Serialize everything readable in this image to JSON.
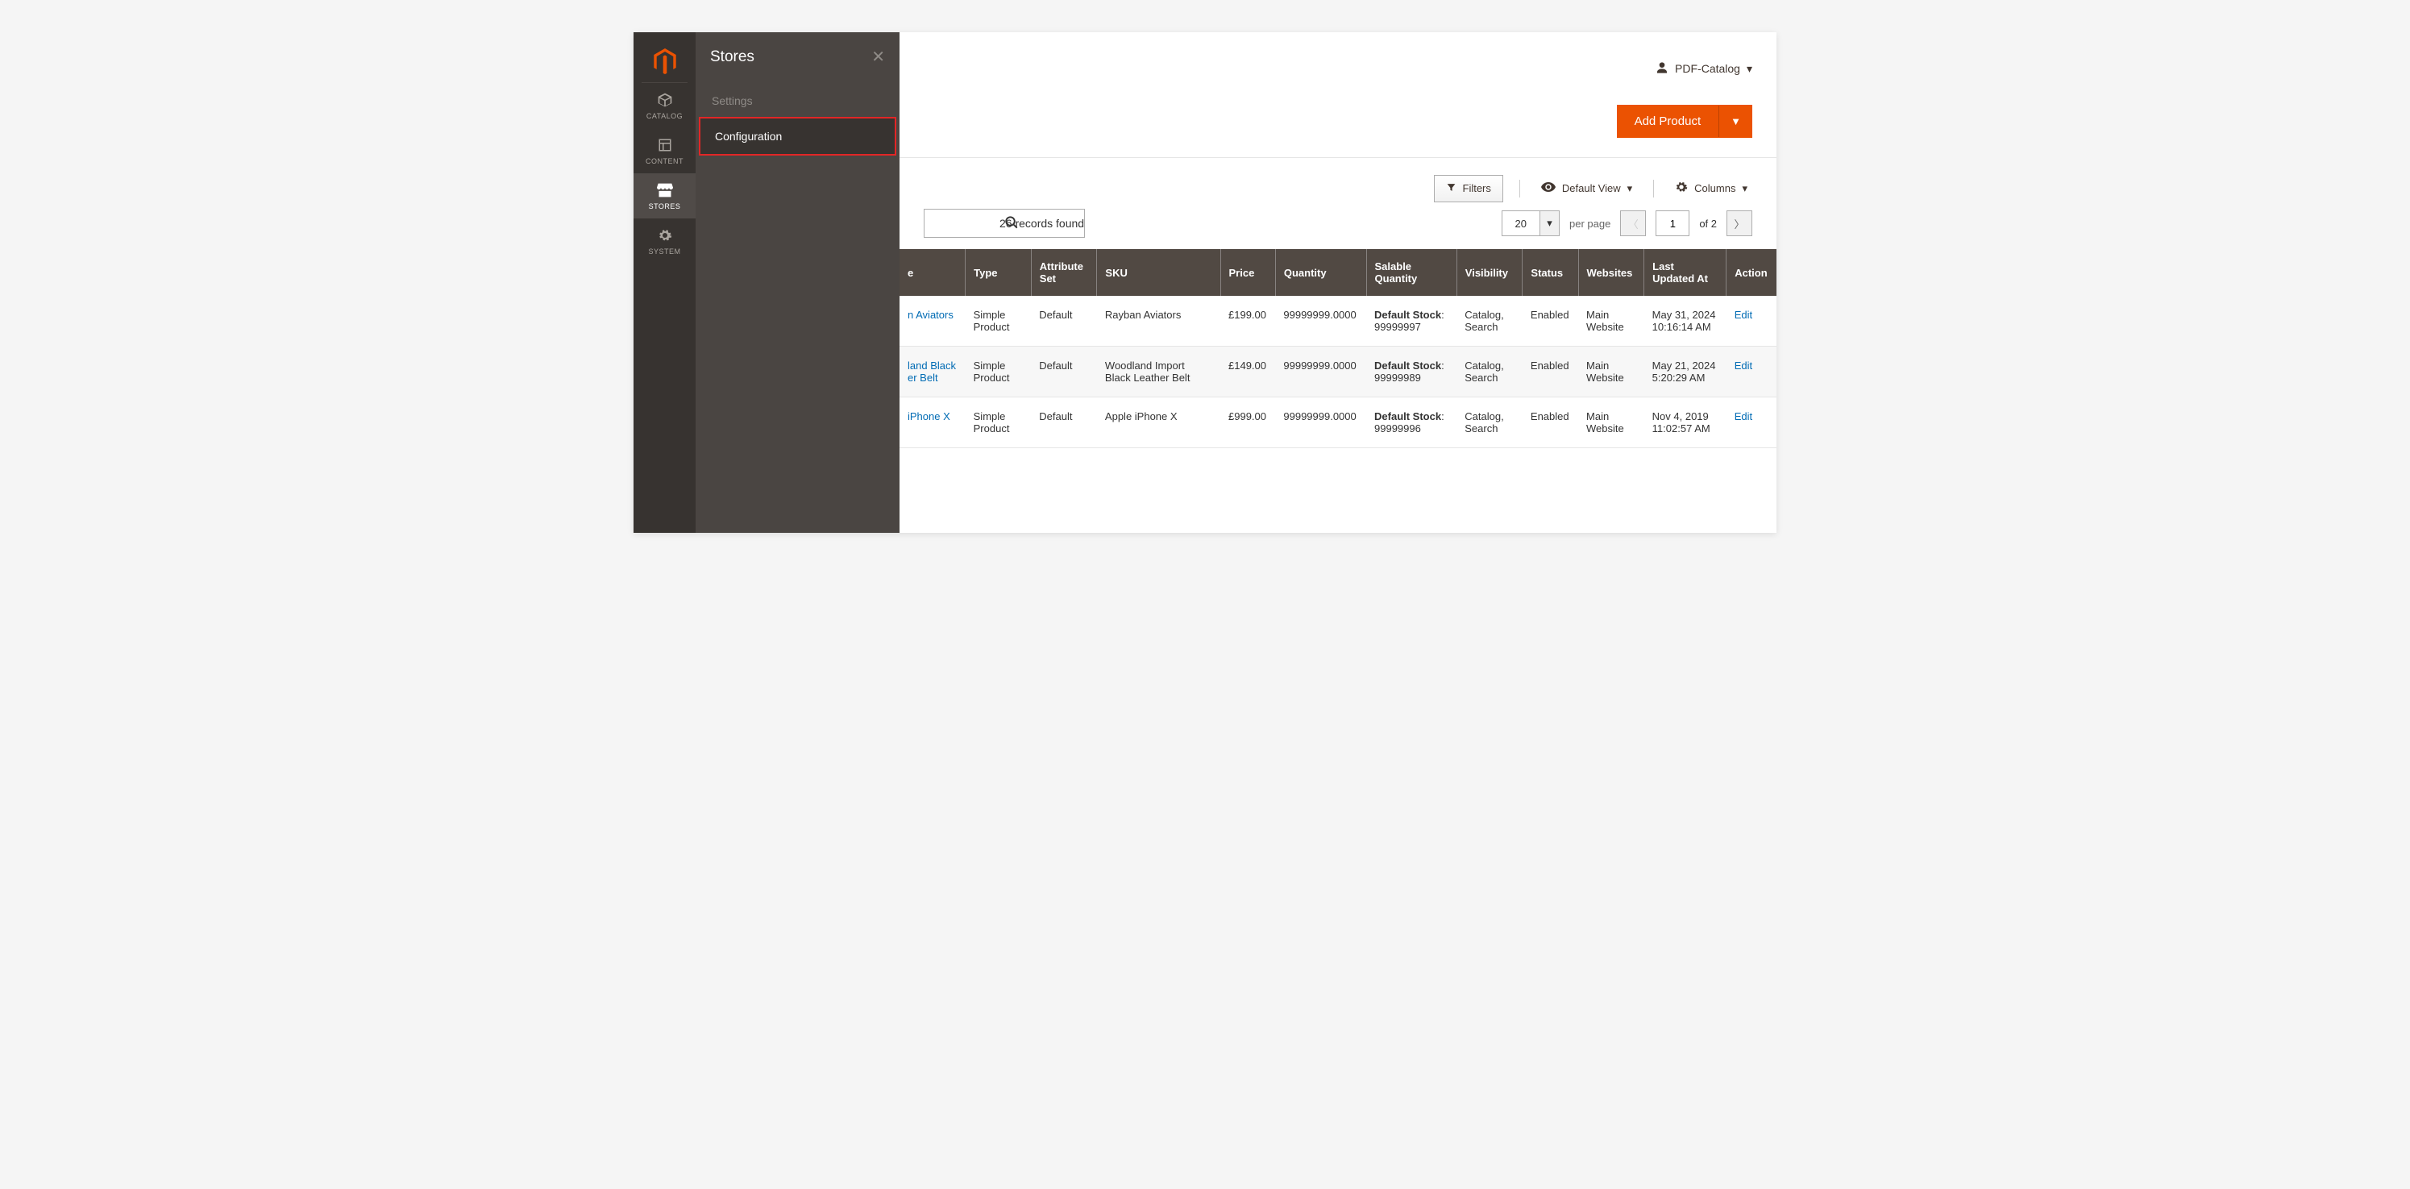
{
  "rail": {
    "items": [
      {
        "key": "catalog",
        "label": "CATALOG"
      },
      {
        "key": "content",
        "label": "CONTENT"
      },
      {
        "key": "stores",
        "label": "STORES"
      },
      {
        "key": "system",
        "label": "SYSTEM"
      }
    ]
  },
  "flyout": {
    "title": "Stores",
    "section": "Settings",
    "item": "Configuration"
  },
  "header": {
    "user": "PDF-Catalog",
    "add_product": "Add Product"
  },
  "toolbar": {
    "filters": "Filters",
    "default_view": "Default View",
    "columns": "Columns"
  },
  "records": {
    "count_text": "26 records found"
  },
  "pagination": {
    "per_page_value": "20",
    "per_page_label": "per page",
    "page_value": "1",
    "of_text": "of 2"
  },
  "columns": [
    "e",
    "Type",
    "Attribute Set",
    "SKU",
    "Price",
    "Quantity",
    "Salable Quantity",
    "Visibility",
    "Status",
    "Websites",
    "Last Updated At",
    "Action"
  ],
  "rows": [
    {
      "name": "n Aviators",
      "type": "Simple Product",
      "attr_set": "Default",
      "sku": "Rayban Aviators",
      "price": "£199.00",
      "qty": "99999999.0000",
      "salable_label": "Default Stock",
      "salable_qty": "99999997",
      "visibility": "Catalog, Search",
      "status": "Enabled",
      "websites": "Main Website",
      "updated": "May 31, 2024 10:16:14 AM",
      "action": "Edit"
    },
    {
      "name": "land Black\ner Belt",
      "type": "Simple Product",
      "attr_set": "Default",
      "sku": "Woodland Import Black Leather Belt",
      "price": "£149.00",
      "qty": "99999999.0000",
      "salable_label": "Default Stock",
      "salable_qty": "99999989",
      "visibility": "Catalog, Search",
      "status": "Enabled",
      "websites": "Main Website",
      "updated": "May 21, 2024 5:20:29 AM",
      "action": "Edit"
    },
    {
      "name": "iPhone X",
      "type": "Simple Product",
      "attr_set": "Default",
      "sku": "Apple iPhone X",
      "price": "£999.00",
      "qty": "99999999.0000",
      "salable_label": "Default Stock",
      "salable_qty": "99999996",
      "visibility": "Catalog, Search",
      "status": "Enabled",
      "websites": "Main Website",
      "updated": "Nov 4, 2019 11:02:57 AM",
      "action": "Edit"
    }
  ]
}
